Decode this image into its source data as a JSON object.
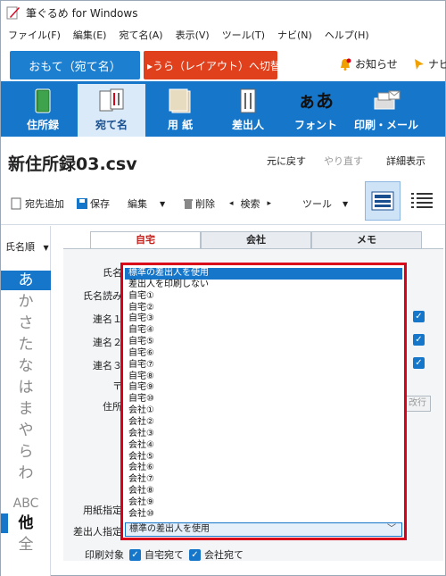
{
  "window": {
    "title": "筆ぐるめ for Windows"
  },
  "menu": [
    "ファイル(F)",
    "編集(E)",
    "宛て名(A)",
    "表示(V)",
    "ツール(T)",
    "ナビ(N)",
    "ヘルプ(H)"
  ],
  "modes": {
    "front": "おもて（宛て名）",
    "back": "▸うら（レイアウト）へ切替"
  },
  "notice": "お知らせ",
  "navi": "ナビ",
  "toolbar": [
    {
      "label": "住所録",
      "icon": "address-book-icon"
    },
    {
      "label": "宛て名",
      "icon": "address-cards-icon"
    },
    {
      "label": "用 紙",
      "icon": "paper-icon"
    },
    {
      "label": "差出人",
      "icon": "sender-icon"
    },
    {
      "label": "フォント",
      "icon": "font-icon"
    },
    {
      "label": "印刷・メール",
      "icon": "printer-icon"
    }
  ],
  "font_glyph": "ぁあ",
  "page_title": "新住所録03.csv",
  "actions": {
    "undo": "元に戻す",
    "redo": "やり直す",
    "detail": "詳細表示"
  },
  "toolbar2": {
    "add": "宛先追加",
    "save": "保存",
    "edit": "編集",
    "delete": "削除",
    "search": "検索",
    "tool": "ツール",
    "dropdown_arrow": "▼",
    "left_arrow": "◂",
    "right_arrow": "▸"
  },
  "sidebar": {
    "sort": "氏名順",
    "kana": [
      "あ",
      "か",
      "さ",
      "た",
      "な",
      "は",
      "ま",
      "や",
      "ら",
      "わ",
      "ABC",
      "他",
      "全"
    ]
  },
  "tabs": [
    "自宅",
    "会社",
    "メモ"
  ],
  "form": {
    "name_label": "氏名",
    "yomi_label": "氏名読み",
    "ren1_label": "連名１",
    "ren2_label": "連名２",
    "ren3_label": "連名３",
    "zip_label": "〒",
    "addr_label": "住所",
    "paper_label": "用紙指定",
    "sender_label": "差出人指定",
    "linebreak_btn": "改行"
  },
  "dropdown": {
    "selected": "標準の差出人を使用",
    "options": [
      "標準の差出人を使用",
      "差出人を印刷しない",
      "自宅①",
      "自宅②",
      "自宅③",
      "自宅④",
      "自宅⑤",
      "自宅⑥",
      "自宅⑦",
      "自宅⑧",
      "自宅⑨",
      "自宅⑩",
      "会社①",
      "会社②",
      "会社③",
      "会社④",
      "会社⑤",
      "会社⑥",
      "会社⑦",
      "会社⑧",
      "会社⑨",
      "会社⑩"
    ]
  },
  "print": {
    "label": "印刷対象",
    "home": "自宅宛て",
    "company": "会社宛て"
  },
  "colors": {
    "accent": "#1676c9",
    "mode_back": "#e0401c",
    "highlight_frame": "#d9001b"
  }
}
